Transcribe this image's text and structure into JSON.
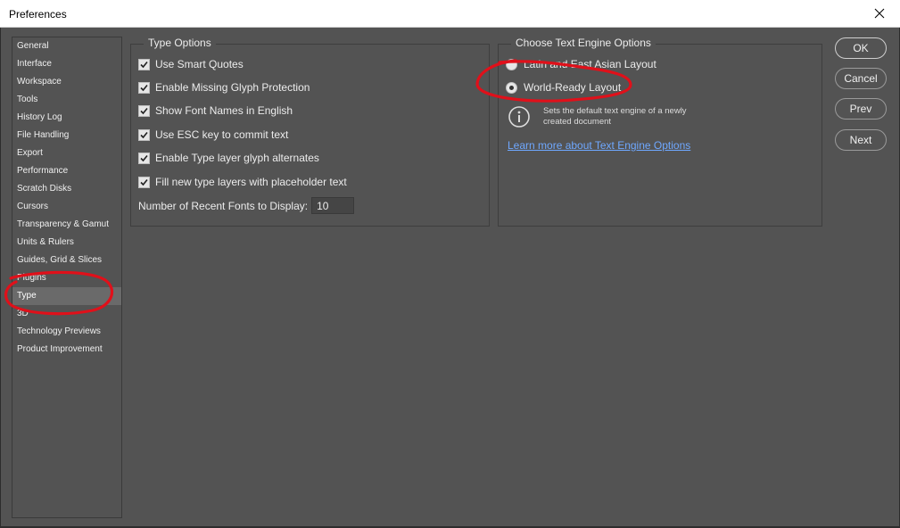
{
  "window": {
    "title": "Preferences"
  },
  "sidebar": {
    "items": [
      {
        "label": "General"
      },
      {
        "label": "Interface"
      },
      {
        "label": "Workspace"
      },
      {
        "label": "Tools"
      },
      {
        "label": "History Log"
      },
      {
        "label": "File Handling"
      },
      {
        "label": "Export"
      },
      {
        "label": "Performance"
      },
      {
        "label": "Scratch Disks"
      },
      {
        "label": "Cursors"
      },
      {
        "label": "Transparency & Gamut"
      },
      {
        "label": "Units & Rulers"
      },
      {
        "label": "Guides, Grid & Slices"
      },
      {
        "label": "Plugins"
      },
      {
        "label": "Type"
      },
      {
        "label": "3D"
      },
      {
        "label": "Technology Previews"
      },
      {
        "label": "Product Improvement"
      }
    ],
    "selected": "Type"
  },
  "type_options": {
    "legend": "Type Options",
    "checkboxes": [
      {
        "label": "Use Smart Quotes",
        "checked": true
      },
      {
        "label": "Enable Missing Glyph Protection",
        "checked": true
      },
      {
        "label": "Show Font Names in English",
        "checked": true
      },
      {
        "label": "Use ESC key to commit text",
        "checked": true
      },
      {
        "label": "Enable Type layer glyph alternates",
        "checked": true
      },
      {
        "label": "Fill new type layers with placeholder text",
        "checked": true
      }
    ],
    "recent_fonts_label": "Number of Recent Fonts to Display:",
    "recent_fonts_value": "10"
  },
  "text_engine": {
    "legend": "Choose Text Engine Options",
    "options": [
      {
        "label": "Latin and East Asian Layout",
        "selected": false
      },
      {
        "label": "World-Ready Layout",
        "selected": true
      }
    ],
    "info_icon": "info-icon",
    "info_text": "Sets the default text engine of a newly created document",
    "link_text": "Learn more about Text Engine Options"
  },
  "buttons": {
    "ok": "OK",
    "cancel": "Cancel",
    "prev": "Prev",
    "next": "Next"
  },
  "colors": {
    "background": "#535353",
    "link": "#6fa8ff",
    "annotation": "#e0101a",
    "selected_item": "#6a6a6a"
  }
}
